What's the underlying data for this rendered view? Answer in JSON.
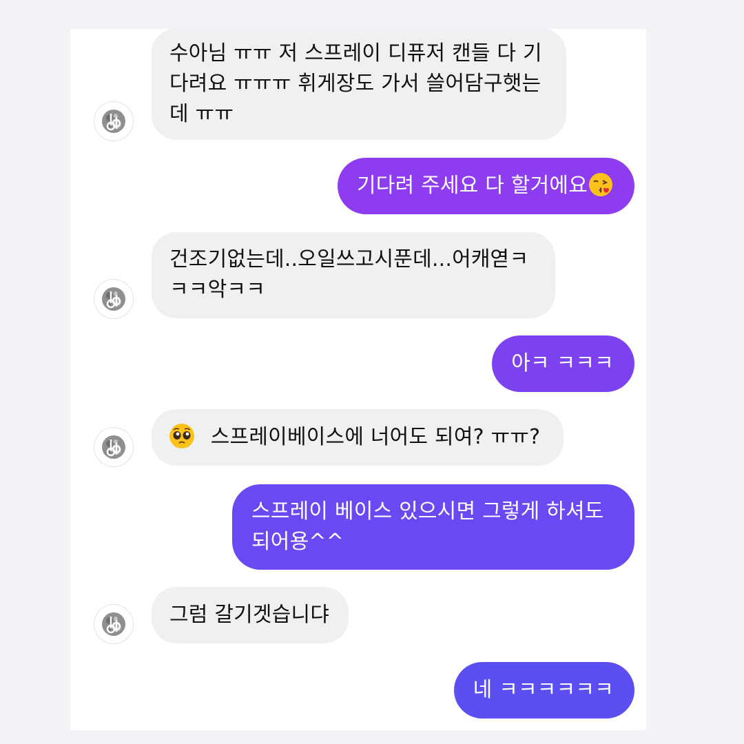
{
  "colors": {
    "incoming_bubble": "#eff0f2",
    "outgoing_bubble_1": "#8d3cf0",
    "outgoing_bubble_2": "#7d42f0",
    "outgoing_bubble_3": "#6a48f2",
    "outgoing_bubble_4": "#5b4ff2",
    "background": "#f2f3f6"
  },
  "messages": [
    {
      "sender": "other",
      "lines": [
        "수아님 ㅠㅠ 저 스프레이 디퓨저 캔들 다 기",
        "다려요 ㅠㅠㅠ 휘게장도 가서 쓸어담구햇는",
        "데 ㅠㅠ"
      ]
    },
    {
      "sender": "me",
      "text": "기다려 주세요 다 할거에요",
      "emoji": "face-blowing-kiss-emoji"
    },
    {
      "sender": "other",
      "lines": [
        "건조기없는데..오일쓰고시푼데...어캐엳ㅋ",
        "ㅋㅋ악ㅋㅋ"
      ]
    },
    {
      "sender": "me",
      "text": "아ㅋ ㅋㅋㅋ"
    },
    {
      "sender": "other",
      "emoji": "pleading-face-emoji",
      "text": "스프레이베이스에 너어도 되여? ㅠㅠ?"
    },
    {
      "sender": "me",
      "lines": [
        "스프레이 베이스 있으시면 그렇게 하셔도",
        "되어용^^"
      ]
    },
    {
      "sender": "other",
      "text": "그럼 갈기겟습니댜"
    },
    {
      "sender": "me",
      "text": "네 ㅋㅋㅋㅋㅋㅋ"
    }
  ]
}
